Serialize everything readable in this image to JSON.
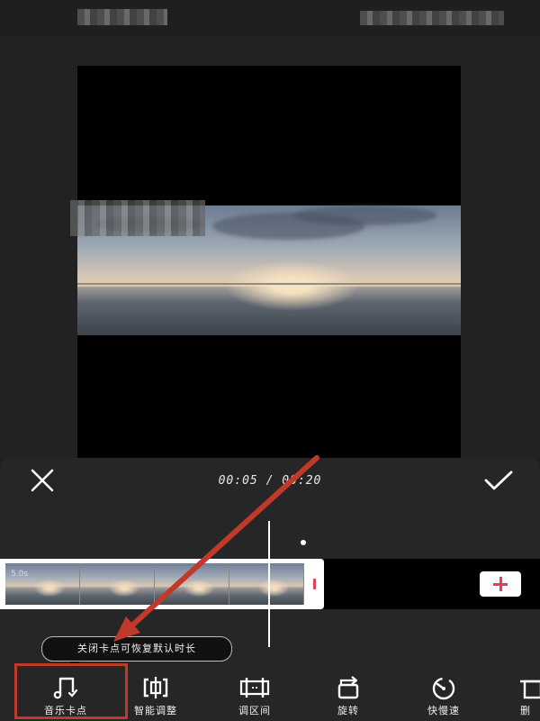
{
  "editor": {
    "time_current": "00:05",
    "time_separator": " / ",
    "time_total": "00:20",
    "clip_label": "5.0s",
    "tooltip": "关闭卡点可恢复默认时长"
  },
  "toolbar": {
    "items": [
      {
        "label": "音乐卡点",
        "icon": "music-note-icon"
      },
      {
        "label": "智能调整",
        "icon": "smart-adjust-icon"
      },
      {
        "label": "调区间",
        "icon": "range-adjust-icon"
      },
      {
        "label": "旋转",
        "icon": "rotate-icon"
      },
      {
        "label": "快慢速",
        "icon": "speed-icon"
      },
      {
        "label": "删",
        "icon": "delete-icon"
      }
    ]
  },
  "colors": {
    "accent": "#e53d5c",
    "annotation": "#c0392b",
    "panel": "#262626"
  }
}
